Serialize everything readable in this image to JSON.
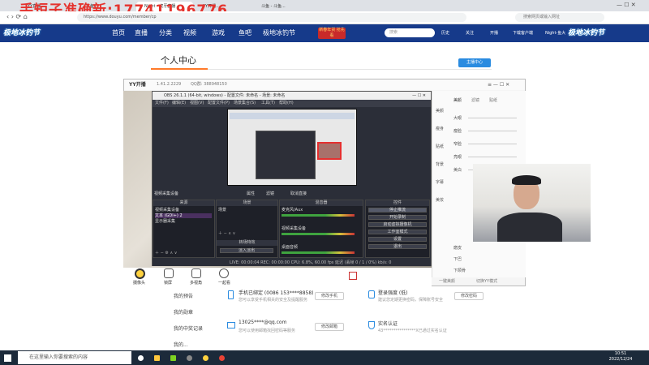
{
  "browser": {
    "tabs": [
      "YY直播...",
      "斗鱼...",
      "Night - 虎牙直播",
      "YY开播...",
      "斗鱼 - 斗鱼..."
    ],
    "url": "https://www.douyu.com/member/cp",
    "search_placeholder": "搜索网页或输入网址"
  },
  "overlay_text": "手短子准确新:17741196776",
  "site": {
    "logo": "极地冰钓节",
    "nav": [
      "首页",
      "直播",
      "分类",
      "视频",
      "游戏",
      "鱼吧",
      "极地冰钓节"
    ],
    "search_placeholder": "搜索",
    "promo": "新春年货 抢先看",
    "user_items": [
      "历史",
      "关注",
      "开播",
      "下载客户端",
      "Night-鱼大"
    ]
  },
  "page": {
    "title": "个人中心",
    "anchor_button": "主播中心",
    "sidebar": [
      "我的预告",
      "我的勋章",
      "我的中奖记录",
      "我的..."
    ],
    "accounts": [
      {
        "title": "手机已绑定 (0086 153****8858)",
        "sub": "您可以享受手机相关的安全及提醒服务",
        "button": "修改手机",
        "icon": "phone-icon"
      },
      {
        "title": "13025****@qq.com",
        "sub": "您可以使用邮箱找回密码等服务",
        "button": "修改邮箱",
        "icon": "mail-icon"
      },
      {
        "title": "登录强度 (低)",
        "sub": "建议您定期更换密码，保障账号安全",
        "button": "修改密码",
        "icon": "lock-icon"
      },
      {
        "title": "实名认证",
        "sub": "43****************X已通过实名认证",
        "button": "",
        "icon": "shield-icon"
      }
    ]
  },
  "yy": {
    "title": "YY开播",
    "version": "1.41.2.2229",
    "qq": "QQ群: 388948150",
    "bottom_items": [
      "摄像头",
      "锁屏",
      "多视角",
      "一起看"
    ],
    "right_tabs": [
      "美颜",
      "滤镜",
      "贴纸"
    ],
    "right_icons": [
      "美颜",
      "瘦身",
      "贴纸",
      "背景",
      "字幕",
      "美妆"
    ],
    "sliders": [
      "大眼",
      "瘦脸",
      "窄脸",
      "亮眼",
      "美白"
    ],
    "lower_sliders": [
      "磨皮",
      "下巴",
      "下颌骨"
    ],
    "footer": [
      "一键美颜",
      "切换YY模式"
    ]
  },
  "obs": {
    "title": "OBS 26.1.1 (64-bit, windows) - 配置文件: 未命名 - 场景: 未命名",
    "menu": [
      "文件(F)",
      "编辑(E)",
      "视图(V)",
      "配置文件(P)",
      "场景集合(S)",
      "工具(T)",
      "帮助(H)"
    ],
    "source_label": "视频采集设备",
    "filter_buttons": [
      "属性",
      "滤镜",
      "取消直接"
    ],
    "scene_header": "场景",
    "scenes": [
      "视频采集设备",
      "文本 (GDI+) 2",
      "显示器采集"
    ],
    "sources_header": "来源",
    "sources": [
      "场景"
    ],
    "mixer_header": "混音器",
    "mixer": [
      "麦克风/Aux",
      "视频采集设备",
      "桌面音频"
    ],
    "transition_header": "转场特效",
    "transition": "淡入淡出",
    "controls_header": "控件",
    "controls": [
      "停止推流",
      "开始录制",
      "启动虚拟摄像机",
      "工作室模式",
      "设置",
      "退出"
    ],
    "status": "LIVE: 00:00:04   REC: 00:00:00   CPU: 6.8%, 60.00 fps   延迟 (丢帧 0 / 1 / 0%)   kb/s: 0"
  },
  "taskbar": {
    "search": "在这里输入你要搜索的内容",
    "time": "10:51",
    "date": "2022/12/24"
  },
  "colors": {
    "nav_bg": "#163a8a",
    "accent": "#ff7a2a",
    "obs_bg": "#2b2e38",
    "overlay_red": "#e5322d"
  }
}
